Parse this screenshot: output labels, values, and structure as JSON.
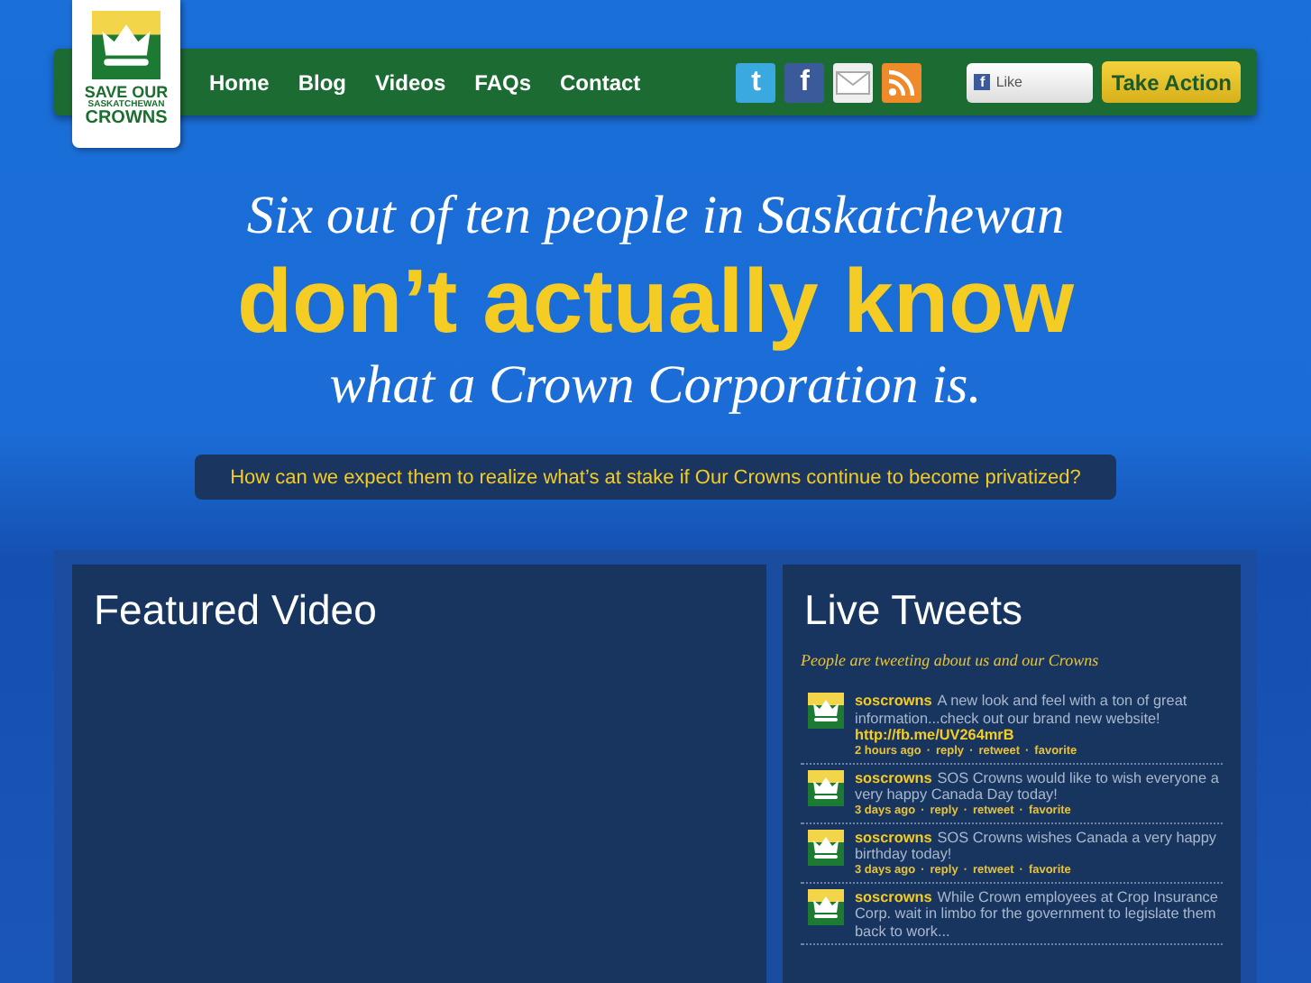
{
  "logo": {
    "lines": [
      "SAVE OUR",
      "SASKATCHEWAN",
      "CROWNS"
    ]
  },
  "nav": {
    "items": [
      "Home",
      "Blog",
      "Videos",
      "FAQs",
      "Contact"
    ],
    "social": [
      {
        "kind": "twitter",
        "glyph": "t"
      },
      {
        "kind": "facebook",
        "glyph": "f"
      },
      {
        "kind": "mail"
      },
      {
        "kind": "rss"
      }
    ],
    "like": {
      "glyph": "f",
      "label": "Like"
    },
    "action": "Take Action"
  },
  "hero": {
    "line1": "Six out of ten people in Saskatchewan",
    "line2": "don’t actually know",
    "line3": "what a Crown Corporation is.",
    "question": "How can we expect them to realize what’s at stake if Our Crowns continue to become privatized?"
  },
  "featured": {
    "title": "Featured Video"
  },
  "tweets_panel": {
    "title": "Live Tweets",
    "subtitle": "People are tweeting about us and our Crowns",
    "separator": "·",
    "tweets": [
      {
        "user": "soscrowns",
        "text": "A new look and feel with a ton of great information...check out our brand new website!",
        "link": "http://fb.me/UV264mrB",
        "time": "2 hours ago",
        "actions": [
          "reply",
          "retweet",
          "favorite"
        ]
      },
      {
        "user": "soscrowns",
        "text": "SOS Crowns would like to wish everyone a very happy Canada Day today!",
        "time": "3 days ago",
        "actions": [
          "reply",
          "retweet",
          "favorite"
        ]
      },
      {
        "user": "soscrowns",
        "text": "SOS Crowns wishes Canada a very happy birthday today!",
        "time": "3 days ago",
        "actions": [
          "reply",
          "retweet",
          "favorite"
        ]
      },
      {
        "user": "soscrowns",
        "text": "While Crown employees at Crop Insurance Corp. wait in limbo for the government to legislate them back to work..."
      }
    ]
  }
}
